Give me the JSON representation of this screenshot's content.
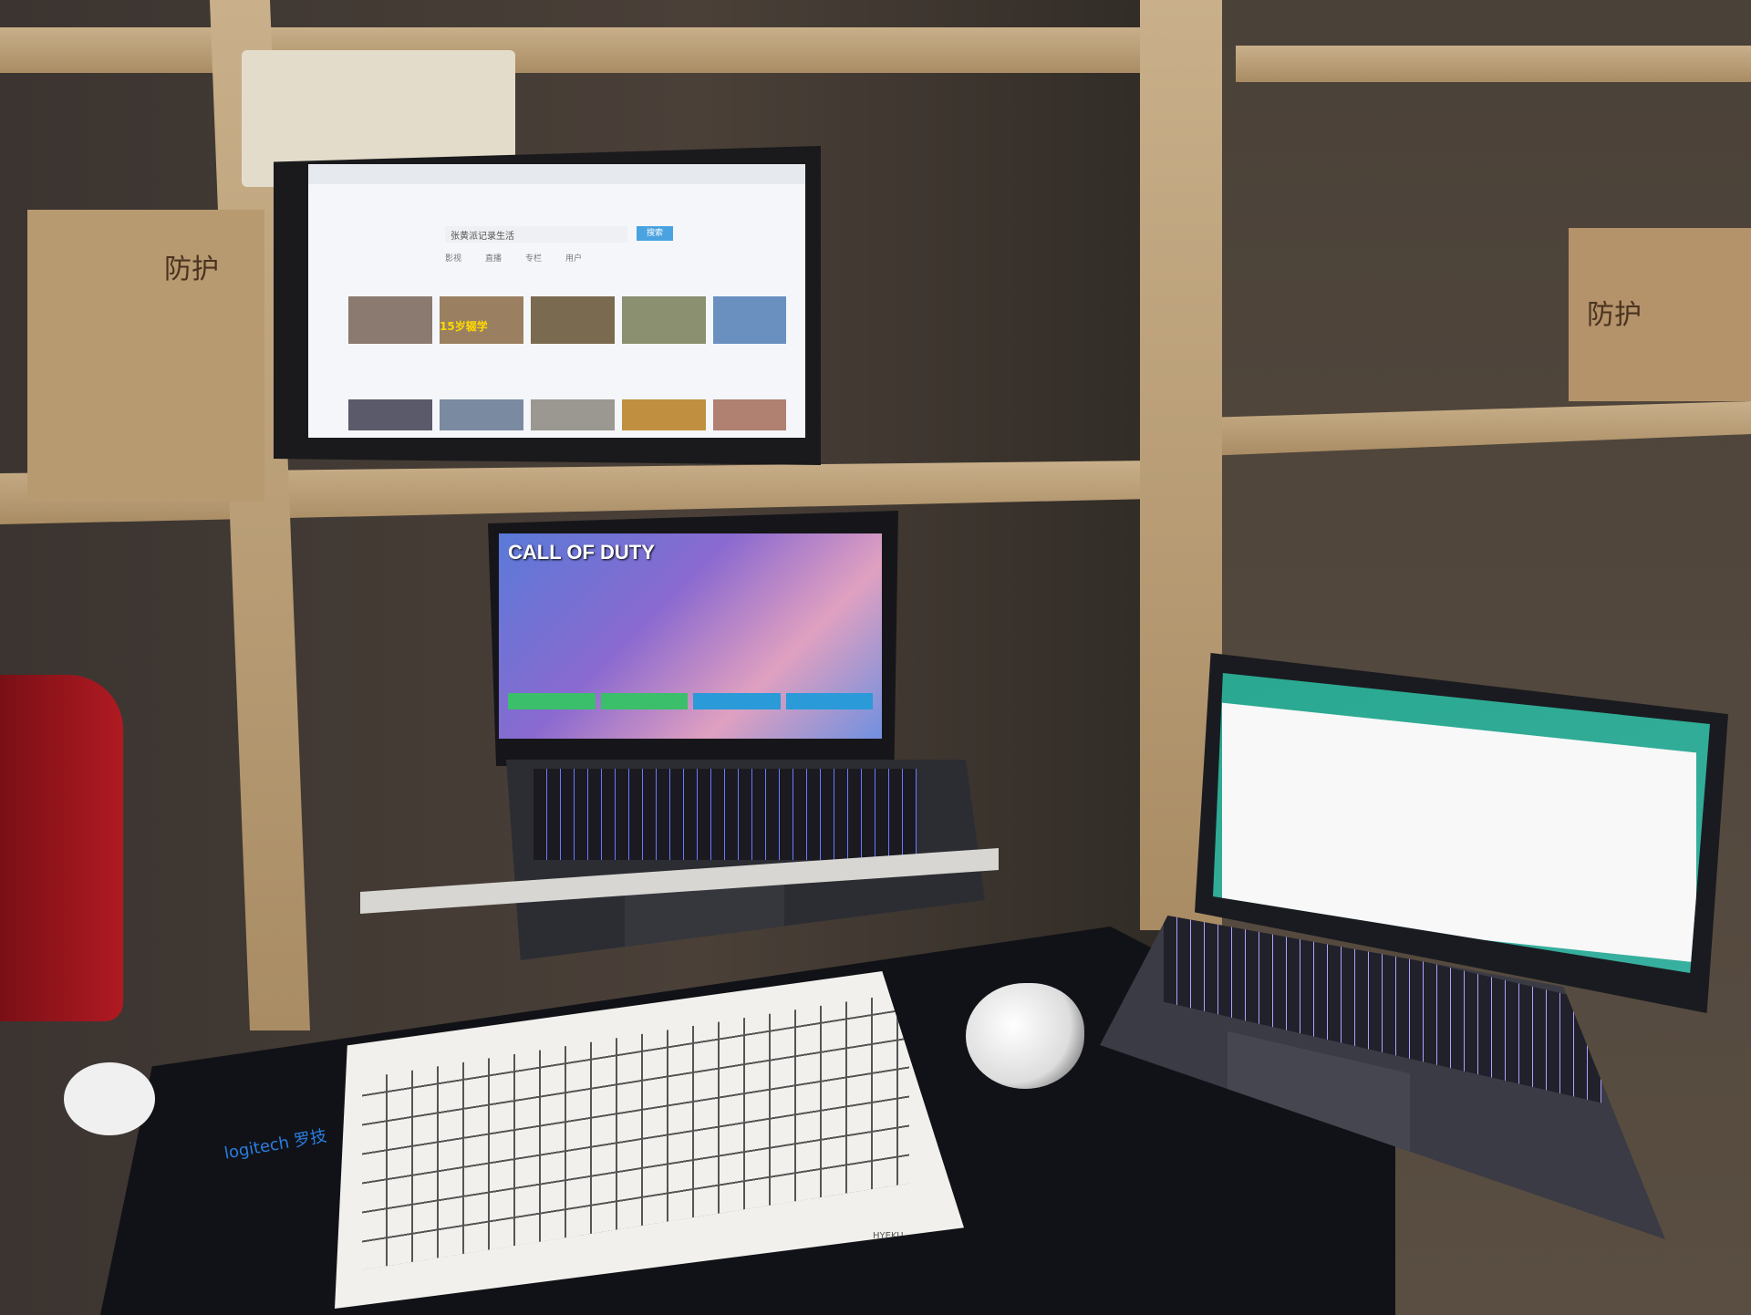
{
  "monitor": {
    "search_query": "张黄派记录生活",
    "search_button": "搜索",
    "tabs": [
      "影视",
      "直播",
      "专栏",
      "用户"
    ],
    "thumb_caption": "15岁辍学"
  },
  "game": {
    "title": "CALL OF DUTY"
  },
  "mousepad": {
    "brand": "logitech 罗技"
  },
  "keyboard": {
    "brand": "HYEKU"
  },
  "box": {
    "label": "防护"
  },
  "colors": {
    "wood": "#c9b08a",
    "mousepad": "#111217",
    "accent_blue": "#1f6fd1",
    "keyboard": "#f1f0ec"
  }
}
